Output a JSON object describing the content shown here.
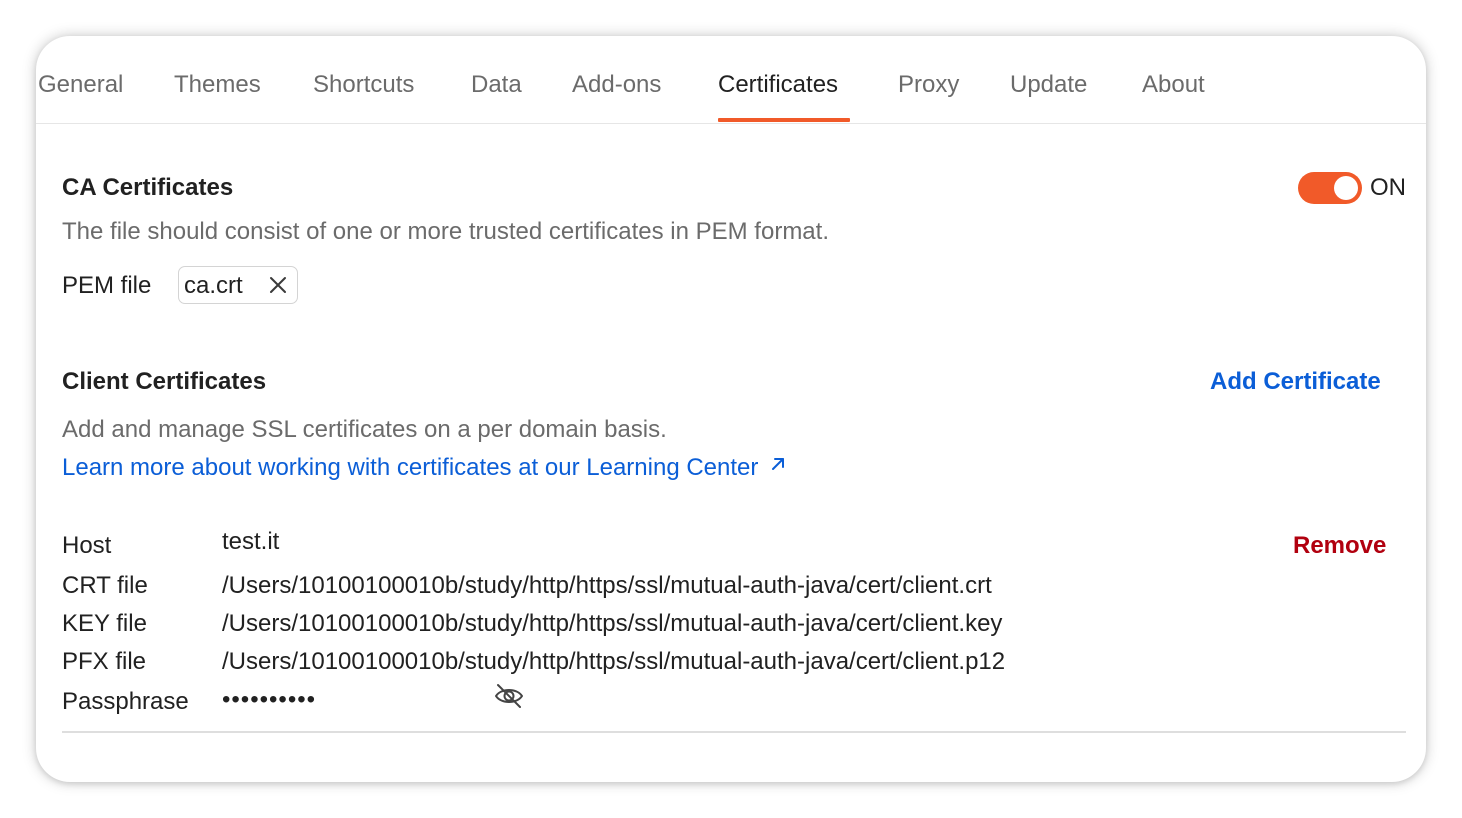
{
  "tabs": [
    {
      "label": "General"
    },
    {
      "label": "Themes"
    },
    {
      "label": "Shortcuts"
    },
    {
      "label": "Data"
    },
    {
      "label": "Add-ons"
    },
    {
      "label": "Certificates",
      "active": true
    },
    {
      "label": "Proxy"
    },
    {
      "label": "Update"
    },
    {
      "label": "About"
    }
  ],
  "ca": {
    "title": "CA Certificates",
    "toggle_state": "ON",
    "description": "The file should consist of one or more trusted certificates in PEM format.",
    "pem_label": "PEM file",
    "pem_file": "ca.crt"
  },
  "client": {
    "title": "Client Certificates",
    "add_label": "Add Certificate",
    "description": "Add and manage SSL certificates on a per domain basis.",
    "learn_link": "Learn more about working with certificates at our Learning Center",
    "learn_link_icon": "external-link-arrow-icon",
    "certificate": {
      "host_label": "Host",
      "host": "test.it",
      "crt_label": "CRT file",
      "crt": "/Users/10100100010b/study/http/https/ssl/mutual-auth-java/cert/client.crt",
      "key_label": "KEY file",
      "key": "/Users/10100100010b/study/http/https/ssl/mutual-auth-java/cert/client.key",
      "pfx_label": "PFX file",
      "pfx": "/Users/10100100010b/study/http/https/ssl/mutual-auth-java/cert/client.p12",
      "passphrase_label": "Passphrase",
      "passphrase": "••••••••••",
      "remove_label": "Remove"
    }
  },
  "colors": {
    "accent": "#f15a29",
    "link": "#0b5ed7",
    "danger": "#b1000f"
  }
}
